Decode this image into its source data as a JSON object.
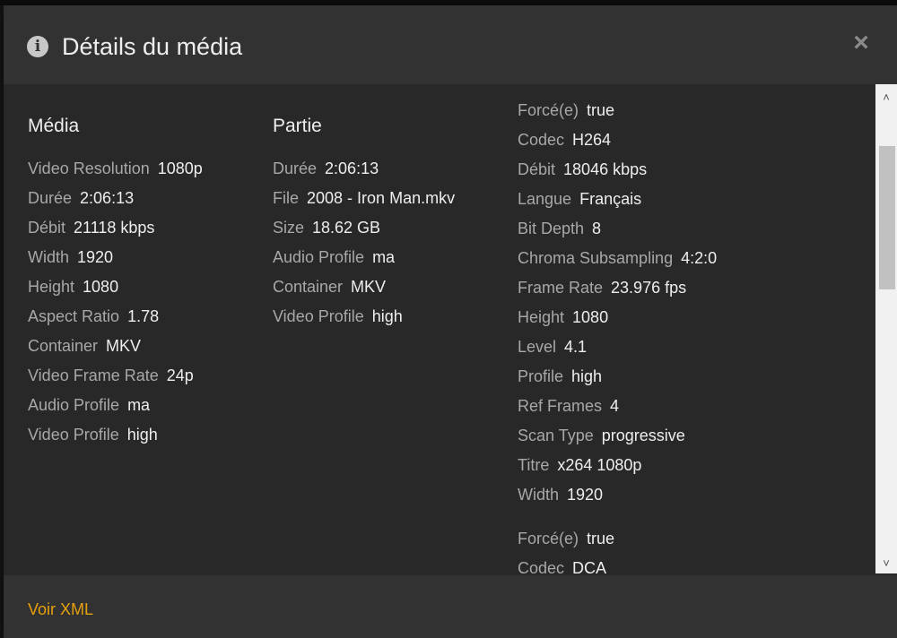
{
  "header": {
    "title": "Détails du média",
    "info_icon": "info-icon",
    "close_label": "×"
  },
  "media": {
    "heading": "Média",
    "rows": [
      {
        "key": "Video Resolution",
        "value": "1080p"
      },
      {
        "key": "Durée",
        "value": "2:06:13"
      },
      {
        "key": "Débit",
        "value": "21118 kbps"
      },
      {
        "key": "Width",
        "value": "1920"
      },
      {
        "key": "Height",
        "value": "1080"
      },
      {
        "key": "Aspect Ratio",
        "value": "1.78"
      },
      {
        "key": "Container",
        "value": "MKV"
      },
      {
        "key": "Video Frame Rate",
        "value": "24p"
      },
      {
        "key": "Audio Profile",
        "value": "ma"
      },
      {
        "key": "Video Profile",
        "value": "high"
      }
    ]
  },
  "part": {
    "heading": "Partie",
    "rows": [
      {
        "key": "Durée",
        "value": "2:06:13"
      },
      {
        "key": "File",
        "value": "2008 - Iron Man.mkv"
      },
      {
        "key": "Size",
        "value": "18.62 GB"
      },
      {
        "key": "Audio Profile",
        "value": "ma"
      },
      {
        "key": "Container",
        "value": "MKV"
      },
      {
        "key": "Video Profile",
        "value": "high"
      }
    ]
  },
  "streams": {
    "video": [
      {
        "key": "Forcé(e)",
        "value": "true"
      },
      {
        "key": "Codec",
        "value": "H264"
      },
      {
        "key": "Débit",
        "value": "18046 kbps"
      },
      {
        "key": "Langue",
        "value": "Français"
      },
      {
        "key": "Bit Depth",
        "value": "8"
      },
      {
        "key": "Chroma Subsampling",
        "value": "4:2:0"
      },
      {
        "key": "Frame Rate",
        "value": "23.976 fps"
      },
      {
        "key": "Height",
        "value": "1080"
      },
      {
        "key": "Level",
        "value": "4.1"
      },
      {
        "key": "Profile",
        "value": "high"
      },
      {
        "key": "Ref Frames",
        "value": "4"
      },
      {
        "key": "Scan Type",
        "value": "progressive"
      },
      {
        "key": "Titre",
        "value": "x264 1080p"
      },
      {
        "key": "Width",
        "value": "1920"
      }
    ],
    "audio": [
      {
        "key": "Forcé(e)",
        "value": "true"
      },
      {
        "key": "Codec",
        "value": "DCA"
      }
    ]
  },
  "scrollbar": {
    "up_arrow": "˄",
    "down_arrow": "˅",
    "position_fraction": 0.13
  },
  "footer": {
    "xml_link": "Voir XML"
  },
  "colors": {
    "accent": "#e5a00d",
    "modal_bg": "#282828",
    "header_bg": "#323232",
    "label": "#a8a8a8",
    "value": "#eeeeee"
  }
}
